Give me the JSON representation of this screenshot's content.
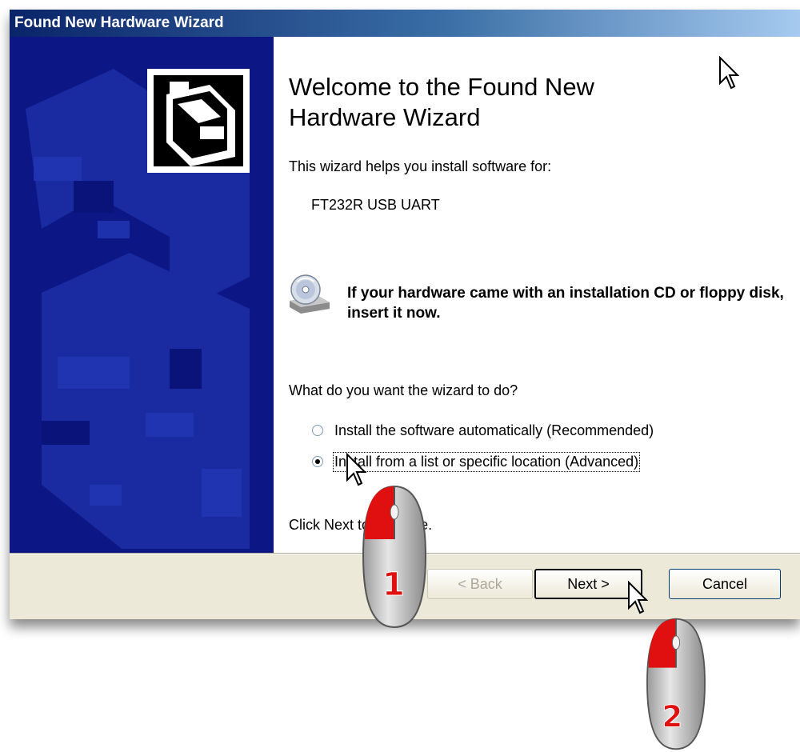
{
  "window": {
    "title": "Found New Hardware Wizard"
  },
  "wizard": {
    "heading": "Welcome to the Found New Hardware Wizard",
    "intro": "This wizard helps you install software for:",
    "device_name": "FT232R USB UART",
    "cd_prompt": "If your hardware came with an installation CD or floppy disk, insert it now.",
    "question": "What do you want the wizard to do?",
    "options": [
      {
        "label": "Install the software automatically (Recommended)",
        "selected": false
      },
      {
        "label": "Install from a list or specific location (Advanced)",
        "selected": true
      }
    ],
    "continue_text": "Click Next to continue."
  },
  "buttons": {
    "back": "< Back",
    "next": "Next >",
    "cancel": "Cancel"
  },
  "annotations": {
    "step1": "1",
    "step2": "2"
  },
  "colors": {
    "titlebar_start": "#0a246a",
    "sidebar": "#0e1a8c",
    "annotation_red": "#e01010"
  },
  "icons": [
    "hardware-wizard-icon",
    "cd-drive-icon",
    "arrow-cursor-icon",
    "mouse-left-click-icon"
  ]
}
